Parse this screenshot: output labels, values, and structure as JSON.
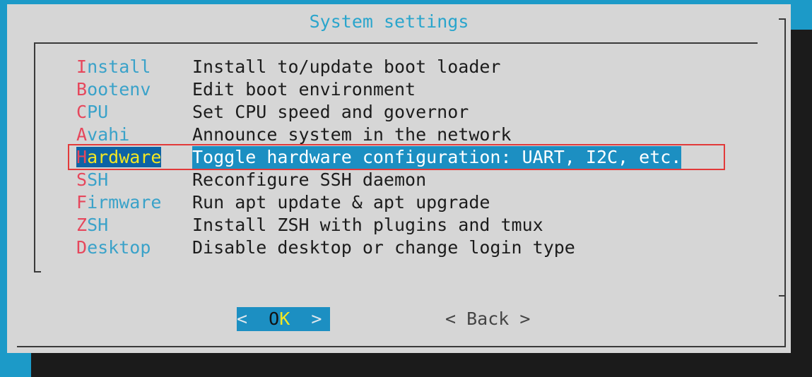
{
  "dialog": {
    "title": "System settings",
    "menu": [
      {
        "tag_hot": "I",
        "tag_rest": "nstall",
        "description": "Install to/update boot loader"
      },
      {
        "tag_hot": "B",
        "tag_rest": "ootenv",
        "description": "Edit boot environment"
      },
      {
        "tag_hot": "C",
        "tag_rest": "PU",
        "description": "Set CPU speed and governor"
      },
      {
        "tag_hot": "A",
        "tag_rest": "vahi",
        "description": "Announce system in the network"
      },
      {
        "tag_hot": "H",
        "tag_rest": "ardware",
        "description": "Toggle hardware configuration: UART, I2C, etc."
      },
      {
        "tag_hot": "S",
        "tag_rest": "SH",
        "description": "Reconfigure SSH daemon"
      },
      {
        "tag_hot": "F",
        "tag_rest": "irmware",
        "description": "Run apt update & apt upgrade"
      },
      {
        "tag_hot": "Z",
        "tag_rest": "SH",
        "description": "Install ZSH with plugins and tmux"
      },
      {
        "tag_hot": "D",
        "tag_rest": "esktop",
        "description": "Disable desktop or change login type"
      }
    ],
    "selected_index": 4,
    "buttons": {
      "ok_left": "<  ",
      "ok_o": "O",
      "ok_k": "K",
      "ok_right": "  >",
      "back": "< Back >"
    }
  },
  "colors": {
    "background": "#1c9ac8",
    "dialog": "#d6d6d6",
    "title": "#2aa5cc",
    "hotkey": "#e6475c",
    "selection": "#1c8fc2",
    "highlight_box": "#e23a3a"
  }
}
